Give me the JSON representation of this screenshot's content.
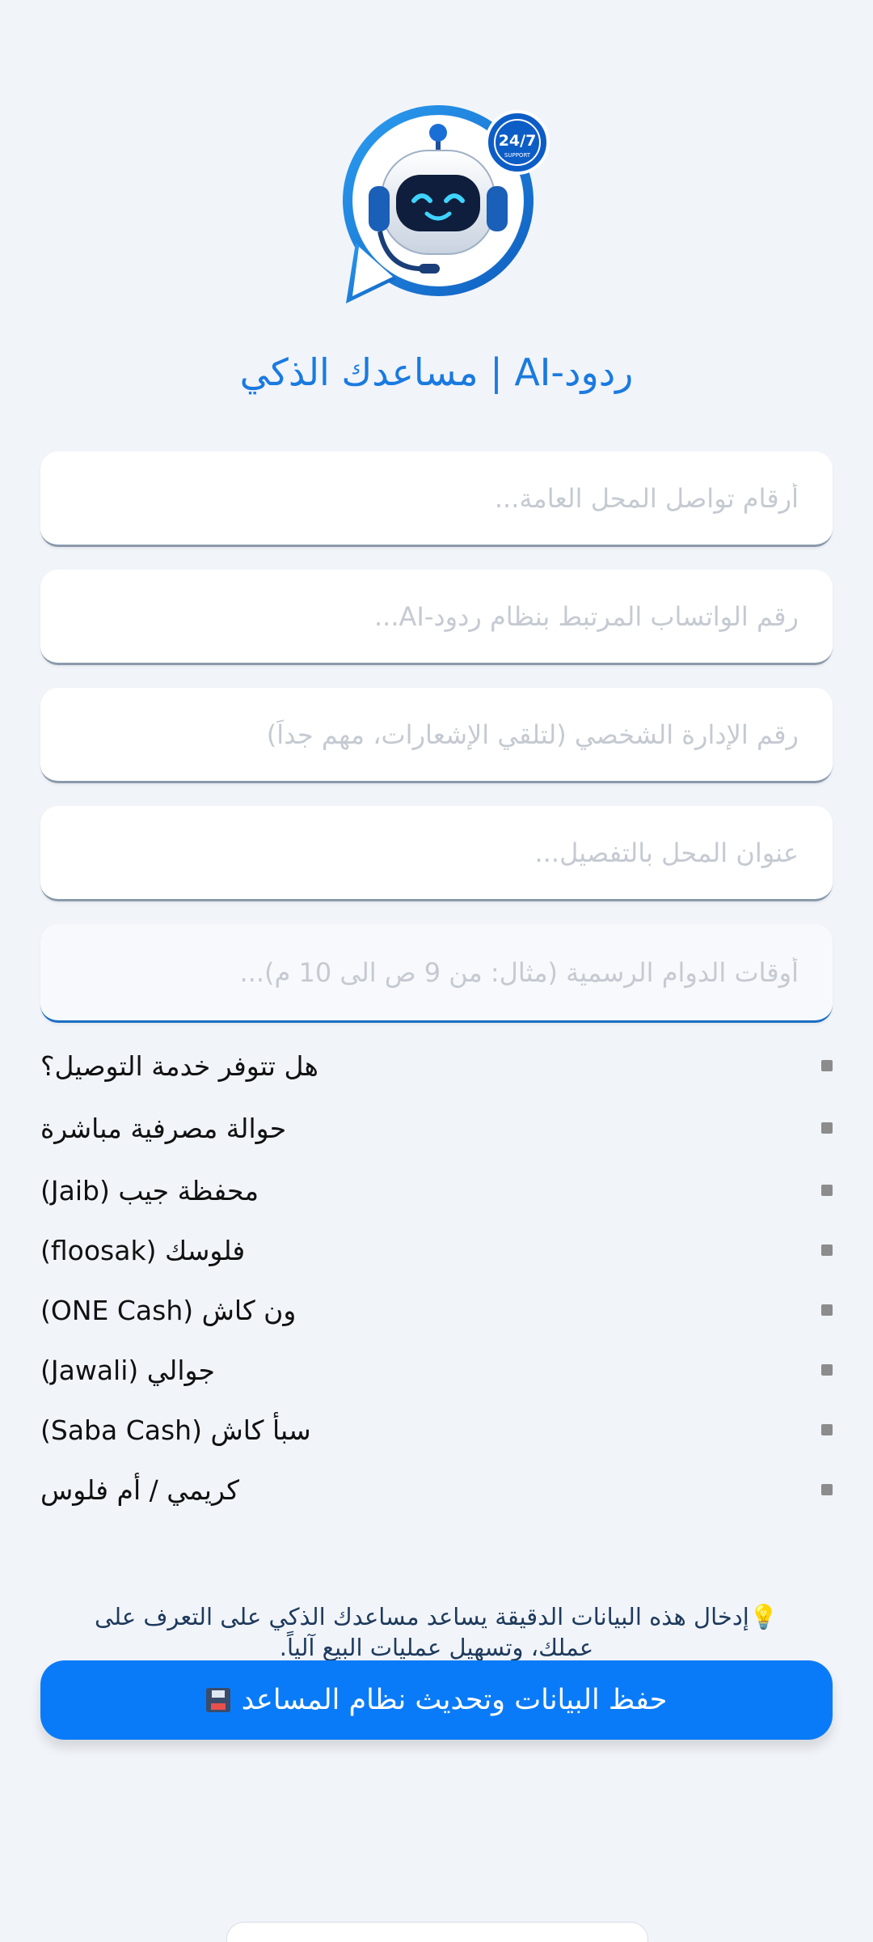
{
  "header": {
    "logo_icon": "robot-support-24-7-icon",
    "badge_text": "24/7",
    "badge_subtext": "SUPPORT",
    "title": "ردود-AI | مساعدك الذكي"
  },
  "form": {
    "fields": [
      {
        "placeholder": "أرقام تواصل المحل العامة...",
        "value": ""
      },
      {
        "placeholder": "رقم الواتساب المرتبط بنظام ردود-AI...",
        "value": ""
      },
      {
        "placeholder": "رقم الإدارة الشخصي (لتلقي الإشعارات، مهم جداً)",
        "value": ""
      },
      {
        "placeholder": "عنوان المحل بالتفصيل...",
        "value": ""
      },
      {
        "placeholder": "أوقات الدوام الرسمية (مثال: من 9 ص الى 10 م)...",
        "value": ""
      }
    ],
    "options": [
      "هل تتوفر خدمة التوصيل؟",
      "حوالة مصرفية مباشرة",
      "محفظة جيب (Jaib)",
      "فلوسك (floosak)",
      "ون كاش (ONE Cash)",
      "جوالي (Jawali)",
      "سبأ كاش (Saba Cash)",
      "كريمي / أم فلوس"
    ]
  },
  "hint": {
    "icon": "lightbulb-icon",
    "text": "💡إدخال هذه البيانات الدقيقة يساعد مساعدك الذكي على التعرف على عملك، وتسهيل عمليات البيع آلياً."
  },
  "save_button": {
    "icon": "floppy-disk-icon",
    "label": "حفظ البيانات وتحديث نظام المساعد"
  },
  "colors": {
    "background": "#f1f4f9",
    "accent": "#0a7bf8",
    "title": "#1a7ae0"
  }
}
